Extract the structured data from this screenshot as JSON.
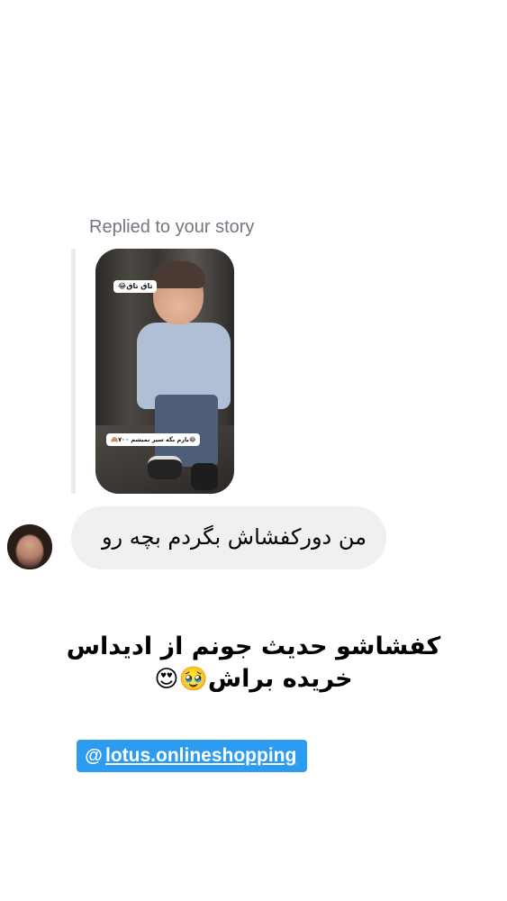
{
  "reply": {
    "label": "Replied to your story"
  },
  "story": {
    "sticker_top": "😂تاق تاق",
    "sticker_bottom": "🙈۷۰۰ بارم بگه سیر نمیشم😂"
  },
  "message": {
    "text": "من دورکفشاش بگردم بچه رو"
  },
  "caption": {
    "line1": "کفشاشو حدیث جونم از ادیداس",
    "line2_text": "خریده براش",
    "line2_emojis": "🥹😍"
  },
  "mention": {
    "icon": "threads-icon",
    "handle": "lotus.onlineshopping"
  },
  "colors": {
    "bubble_bg": "#eff0f2",
    "label_gray": "#737780",
    "mention_blue": "#2d9cf0"
  }
}
